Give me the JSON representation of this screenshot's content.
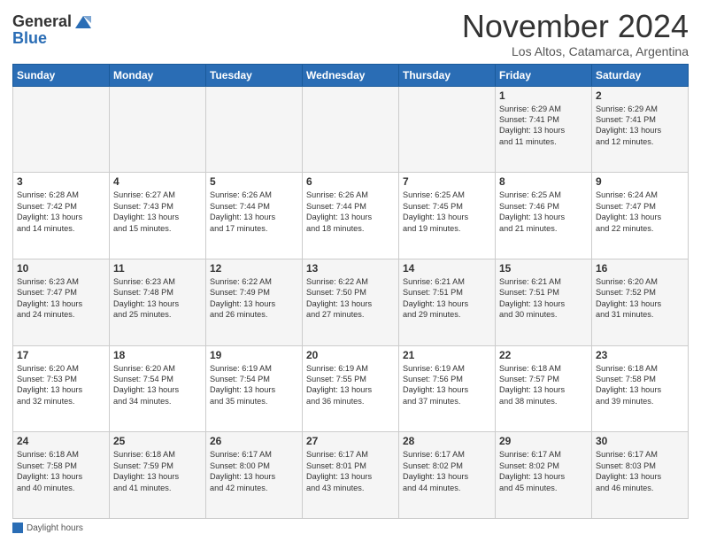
{
  "header": {
    "logo_general": "General",
    "logo_blue": "Blue",
    "month_title": "November 2024",
    "location": "Los Altos, Catamarca, Argentina"
  },
  "days_of_week": [
    "Sunday",
    "Monday",
    "Tuesday",
    "Wednesday",
    "Thursday",
    "Friday",
    "Saturday"
  ],
  "legend_label": "Daylight hours",
  "weeks": [
    [
      {
        "day": "",
        "info": ""
      },
      {
        "day": "",
        "info": ""
      },
      {
        "day": "",
        "info": ""
      },
      {
        "day": "",
        "info": ""
      },
      {
        "day": "",
        "info": ""
      },
      {
        "day": "1",
        "info": "Sunrise: 6:29 AM\nSunset: 7:41 PM\nDaylight: 13 hours\nand 11 minutes."
      },
      {
        "day": "2",
        "info": "Sunrise: 6:29 AM\nSunset: 7:41 PM\nDaylight: 13 hours\nand 12 minutes."
      }
    ],
    [
      {
        "day": "3",
        "info": "Sunrise: 6:28 AM\nSunset: 7:42 PM\nDaylight: 13 hours\nand 14 minutes."
      },
      {
        "day": "4",
        "info": "Sunrise: 6:27 AM\nSunset: 7:43 PM\nDaylight: 13 hours\nand 15 minutes."
      },
      {
        "day": "5",
        "info": "Sunrise: 6:26 AM\nSunset: 7:44 PM\nDaylight: 13 hours\nand 17 minutes."
      },
      {
        "day": "6",
        "info": "Sunrise: 6:26 AM\nSunset: 7:44 PM\nDaylight: 13 hours\nand 18 minutes."
      },
      {
        "day": "7",
        "info": "Sunrise: 6:25 AM\nSunset: 7:45 PM\nDaylight: 13 hours\nand 19 minutes."
      },
      {
        "day": "8",
        "info": "Sunrise: 6:25 AM\nSunset: 7:46 PM\nDaylight: 13 hours\nand 21 minutes."
      },
      {
        "day": "9",
        "info": "Sunrise: 6:24 AM\nSunset: 7:47 PM\nDaylight: 13 hours\nand 22 minutes."
      }
    ],
    [
      {
        "day": "10",
        "info": "Sunrise: 6:23 AM\nSunset: 7:47 PM\nDaylight: 13 hours\nand 24 minutes."
      },
      {
        "day": "11",
        "info": "Sunrise: 6:23 AM\nSunset: 7:48 PM\nDaylight: 13 hours\nand 25 minutes."
      },
      {
        "day": "12",
        "info": "Sunrise: 6:22 AM\nSunset: 7:49 PM\nDaylight: 13 hours\nand 26 minutes."
      },
      {
        "day": "13",
        "info": "Sunrise: 6:22 AM\nSunset: 7:50 PM\nDaylight: 13 hours\nand 27 minutes."
      },
      {
        "day": "14",
        "info": "Sunrise: 6:21 AM\nSunset: 7:51 PM\nDaylight: 13 hours\nand 29 minutes."
      },
      {
        "day": "15",
        "info": "Sunrise: 6:21 AM\nSunset: 7:51 PM\nDaylight: 13 hours\nand 30 minutes."
      },
      {
        "day": "16",
        "info": "Sunrise: 6:20 AM\nSunset: 7:52 PM\nDaylight: 13 hours\nand 31 minutes."
      }
    ],
    [
      {
        "day": "17",
        "info": "Sunrise: 6:20 AM\nSunset: 7:53 PM\nDaylight: 13 hours\nand 32 minutes."
      },
      {
        "day": "18",
        "info": "Sunrise: 6:20 AM\nSunset: 7:54 PM\nDaylight: 13 hours\nand 34 minutes."
      },
      {
        "day": "19",
        "info": "Sunrise: 6:19 AM\nSunset: 7:54 PM\nDaylight: 13 hours\nand 35 minutes."
      },
      {
        "day": "20",
        "info": "Sunrise: 6:19 AM\nSunset: 7:55 PM\nDaylight: 13 hours\nand 36 minutes."
      },
      {
        "day": "21",
        "info": "Sunrise: 6:19 AM\nSunset: 7:56 PM\nDaylight: 13 hours\nand 37 minutes."
      },
      {
        "day": "22",
        "info": "Sunrise: 6:18 AM\nSunset: 7:57 PM\nDaylight: 13 hours\nand 38 minutes."
      },
      {
        "day": "23",
        "info": "Sunrise: 6:18 AM\nSunset: 7:58 PM\nDaylight: 13 hours\nand 39 minutes."
      }
    ],
    [
      {
        "day": "24",
        "info": "Sunrise: 6:18 AM\nSunset: 7:58 PM\nDaylight: 13 hours\nand 40 minutes."
      },
      {
        "day": "25",
        "info": "Sunrise: 6:18 AM\nSunset: 7:59 PM\nDaylight: 13 hours\nand 41 minutes."
      },
      {
        "day": "26",
        "info": "Sunrise: 6:17 AM\nSunset: 8:00 PM\nDaylight: 13 hours\nand 42 minutes."
      },
      {
        "day": "27",
        "info": "Sunrise: 6:17 AM\nSunset: 8:01 PM\nDaylight: 13 hours\nand 43 minutes."
      },
      {
        "day": "28",
        "info": "Sunrise: 6:17 AM\nSunset: 8:02 PM\nDaylight: 13 hours\nand 44 minutes."
      },
      {
        "day": "29",
        "info": "Sunrise: 6:17 AM\nSunset: 8:02 PM\nDaylight: 13 hours\nand 45 minutes."
      },
      {
        "day": "30",
        "info": "Sunrise: 6:17 AM\nSunset: 8:03 PM\nDaylight: 13 hours\nand 46 minutes."
      }
    ]
  ]
}
